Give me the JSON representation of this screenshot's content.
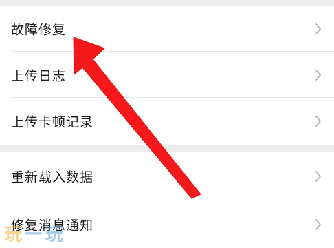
{
  "menu": {
    "group1": [
      {
        "label": "故障修复"
      },
      {
        "label": "上传日志"
      },
      {
        "label": "上传卡顿记录"
      }
    ],
    "group2": [
      {
        "label": "重新载入数据"
      },
      {
        "label": "修复消息通知"
      }
    ]
  },
  "watermark": {
    "char_a": "玩",
    "dash": "—",
    "char_b": "玩"
  },
  "colors": {
    "arrow": "#f5191b",
    "chevron": "#b2b2b2",
    "background": "#ededed",
    "row_background": "#ffffff"
  },
  "icons": [
    "chevron-right-icon",
    "annotation-arrow"
  ]
}
